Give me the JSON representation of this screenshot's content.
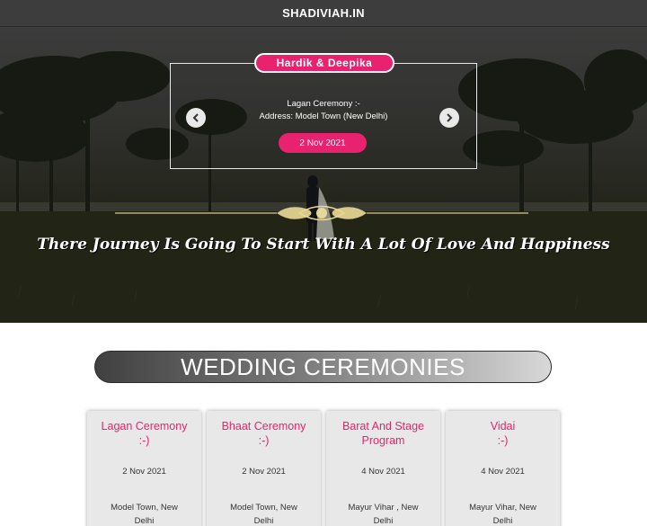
{
  "header": {
    "brand": "SHADIVIAH.IN"
  },
  "hero": {
    "couple": "Hardik & Deepika",
    "event_line": "Lagan Ceremony :-",
    "address_line": "Address: Model Town (New Delhi)",
    "date": "2 Nov 2021",
    "tagline": "There Journey Is Going To Start With A Lot Of Love And Happiness",
    "prev_icon": "chevron-left-icon",
    "next_icon": "chevron-right-icon"
  },
  "section": {
    "title": "WEDDING CEREMONIES"
  },
  "ceremonies": [
    {
      "title_line1": "Lagan Ceremony",
      "title_line2": ":-)",
      "date": "2 Nov 2021",
      "place_line1": "Model Town, New",
      "place_line2": "Delhi"
    },
    {
      "title_line1": "Bhaat Ceremony",
      "title_line2": ":-)",
      "date": "2 Nov 2021",
      "place_line1": "Model Town, New",
      "place_line2": "Delhi"
    },
    {
      "title_line1": "Barat And Stage",
      "title_line2": "Program",
      "date": "4 Nov 2021",
      "place_line1": "Mayur Vihar , New",
      "place_line2": "Delhi"
    },
    {
      "title_line1": "Vidai",
      "title_line2": ":-)",
      "date": "4 Nov 2021",
      "place_line1": "Mayur Vihar, New",
      "place_line2": "Delhi"
    }
  ],
  "colors": {
    "accent": "#e8226e",
    "topbar": "#3d3d3d",
    "card": "#e8e8e8"
  }
}
